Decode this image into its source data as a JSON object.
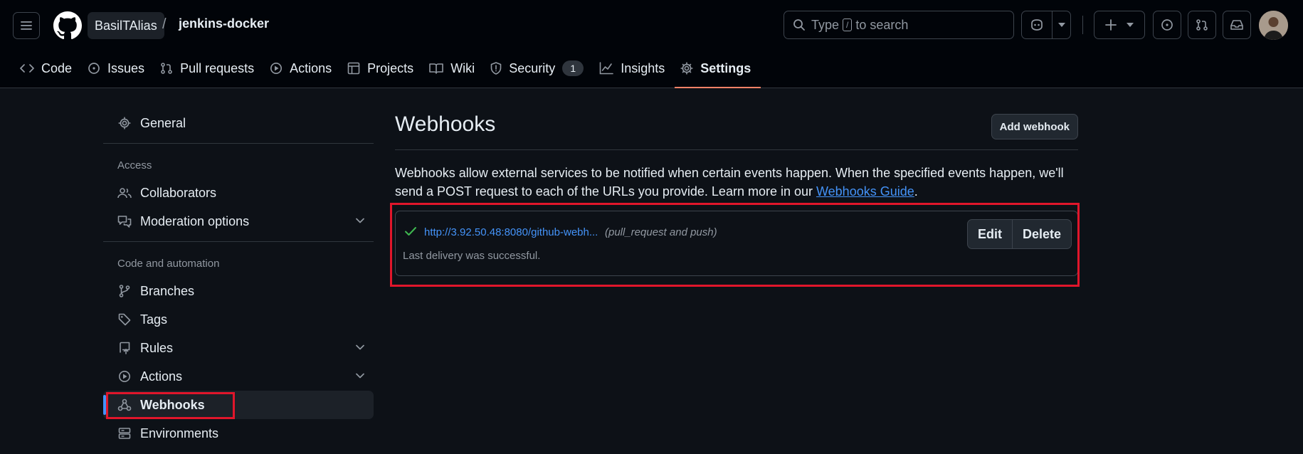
{
  "header": {
    "owner": "BasilTAlias",
    "separator": "/",
    "repo": "jenkins-docker",
    "search_prefix": "Type",
    "search_key": "/",
    "search_suffix": "to search"
  },
  "tabs": [
    {
      "label": "Code",
      "icon": "code-icon"
    },
    {
      "label": "Issues",
      "icon": "issue-icon"
    },
    {
      "label": "Pull requests",
      "icon": "pull-request-icon"
    },
    {
      "label": "Actions",
      "icon": "play-icon"
    },
    {
      "label": "Projects",
      "icon": "table-icon"
    },
    {
      "label": "Wiki",
      "icon": "book-icon"
    },
    {
      "label": "Security",
      "icon": "shield-icon",
      "count": "1"
    },
    {
      "label": "Insights",
      "icon": "graph-icon"
    },
    {
      "label": "Settings",
      "icon": "gear-icon",
      "selected": true
    }
  ],
  "sidebar": {
    "general": "General",
    "access_heading": "Access",
    "collaborators": "Collaborators",
    "moderation": "Moderation options",
    "code_heading": "Code and automation",
    "branches": "Branches",
    "tags": "Tags",
    "rules": "Rules",
    "actions": "Actions",
    "webhooks": "Webhooks",
    "environments": "Environments"
  },
  "main": {
    "title": "Webhooks",
    "add_button": "Add webhook",
    "description": "Webhooks allow external services to be notified when certain events happen. When the specified events happen, we'll send a POST request to each of the URLs you provide. Learn more in our ",
    "guide_link": "Webhooks Guide",
    "description_end": ".",
    "hook": {
      "url": "http://3.92.50.48:8080/github-webh...",
      "events": "(pull_request and push)",
      "status": "Last delivery was successful.",
      "edit_label": "Edit",
      "delete_label": "Delete"
    }
  },
  "colors": {
    "background": "#0d1117",
    "header_background": "#010409",
    "accent_blue": "#4493f8",
    "success_green": "#3fb950",
    "selected_tab_underline": "#f78166",
    "highlight_red": "#e0162b"
  }
}
